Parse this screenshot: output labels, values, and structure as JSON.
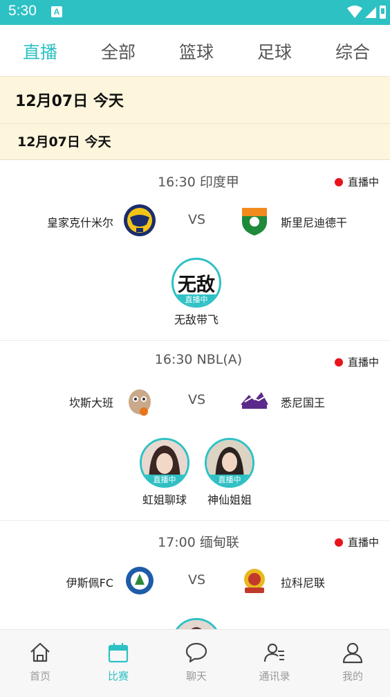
{
  "status_bar": {
    "time": "5:30",
    "badge": "A"
  },
  "tabs": [
    {
      "label": "直播",
      "active": true
    },
    {
      "label": "全部",
      "active": false
    },
    {
      "label": "篮球",
      "active": false
    },
    {
      "label": "足球",
      "active": false
    },
    {
      "label": "综合",
      "active": false
    }
  ],
  "date_header": "12月07日  今天",
  "date_subheader": "12月07日   今天",
  "matches": [
    {
      "time_league": "16:30  印度甲",
      "live_label": "直播中",
      "home": "皇家克什米尔",
      "vs": "VS",
      "away": "斯里尼迪德干",
      "streamers": [
        {
          "name": "无敌带飞",
          "avatar_text": "无敌",
          "live": "直播中"
        }
      ]
    },
    {
      "time_league": "16:30  NBL(A)",
      "live_label": "直播中",
      "home": "坎斯大班",
      "vs": "VS",
      "away": "悉尼国王",
      "streamers": [
        {
          "name": "虹姐聊球",
          "live": "直播中"
        },
        {
          "name": "神仙姐姐",
          "live": "直播中"
        }
      ]
    },
    {
      "time_league": "17:00  缅甸联",
      "live_label": "直播中",
      "home": "伊斯佩FC",
      "vs": "VS",
      "away": "拉科尼联"
    }
  ],
  "bottom_nav": [
    {
      "label": "首页",
      "icon": "home-icon",
      "active": false
    },
    {
      "label": "比赛",
      "icon": "calendar-icon",
      "active": true
    },
    {
      "label": "聊天",
      "icon": "chat-bubble-icon",
      "active": false
    },
    {
      "label": "通讯录",
      "icon": "contacts-icon",
      "active": false
    },
    {
      "label": "我的",
      "icon": "profile-icon",
      "active": false
    }
  ],
  "colors": {
    "accent": "#2ec1c4",
    "date_bg": "#fdf5dc",
    "live_dot": "#e8141c"
  }
}
